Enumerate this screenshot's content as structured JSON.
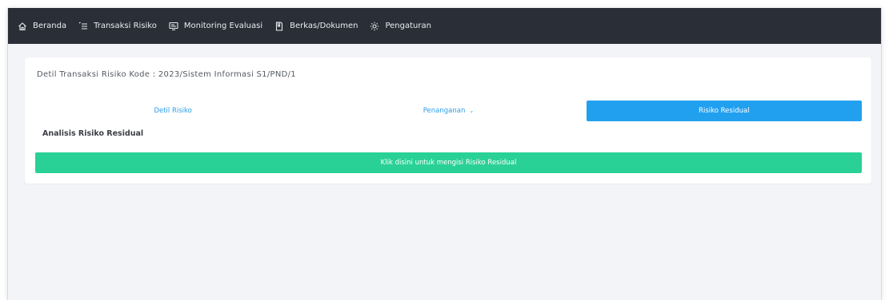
{
  "nav": {
    "items": [
      {
        "label": "Beranda",
        "icon": "home-icon"
      },
      {
        "label": "Transaksi Risiko",
        "icon": "list-icon"
      },
      {
        "label": "Monitoring Evaluasi",
        "icon": "monitor-icon"
      },
      {
        "label": "Berkas/Dokumen",
        "icon": "document-icon"
      },
      {
        "label": "Pengaturan",
        "icon": "gear-icon"
      }
    ]
  },
  "card": {
    "title": "Detil Transaksi Risiko Kode : 2023/Sistem Informasi S1/PND/1",
    "tabs": [
      {
        "label": "Detil Risiko",
        "active": false
      },
      {
        "label": "Penanganan",
        "active": false,
        "dropdown": true
      },
      {
        "label": "Risiko Residual",
        "active": true
      }
    ],
    "section_title": "Analisis Risiko Residual",
    "action_button": "Klik disini untuk mengisi Risiko Residual"
  },
  "colors": {
    "navbar_bg": "#2a2e36",
    "page_bg": "#f3f4f8",
    "tab_active": "#22a0f0",
    "tab_text": "#2a9ee8",
    "action_green": "#2ad196"
  }
}
